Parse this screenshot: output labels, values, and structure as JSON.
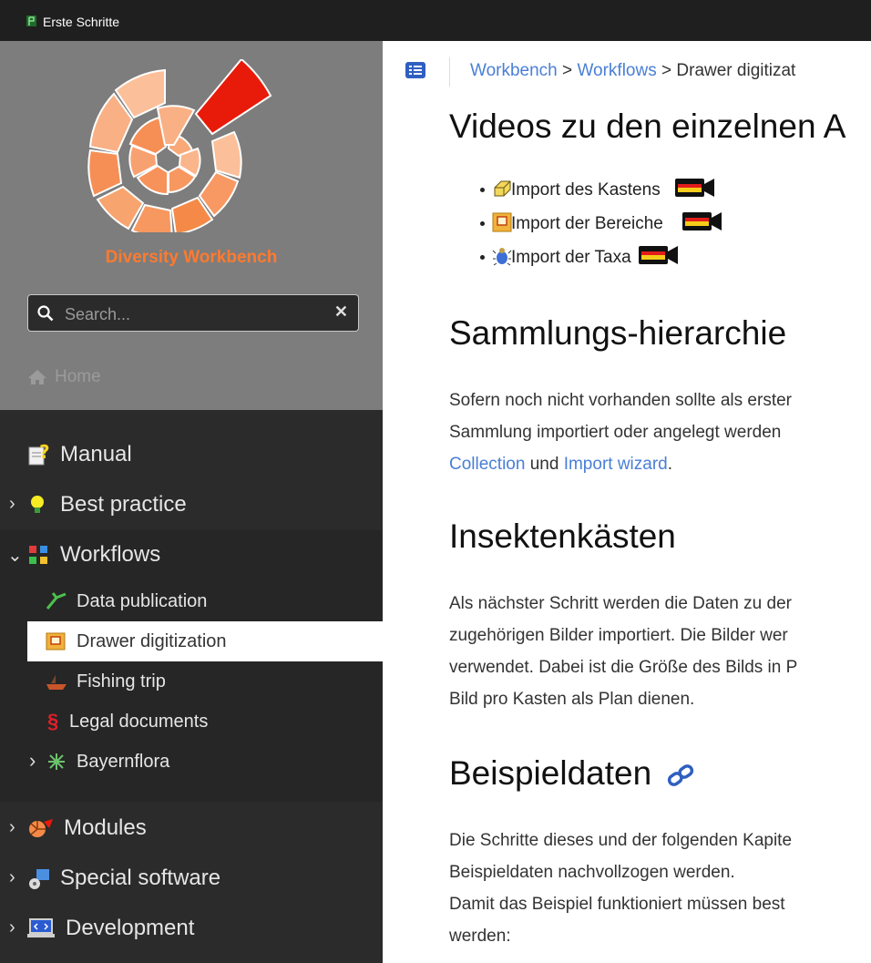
{
  "window": {
    "title": "Erste Schritte"
  },
  "sidebar": {
    "brand": "Diversity Workbench",
    "search": {
      "placeholder": "Search...",
      "clear_label": "✕"
    },
    "home": "Home",
    "nav": [
      {
        "label": "Manual",
        "icon": "manual-icon"
      },
      {
        "label": "Best practice",
        "icon": "lightbulb-icon",
        "expanded": false
      },
      {
        "label": "Workflows",
        "icon": "workflows-icon",
        "expanded": true
      },
      {
        "label": "Modules",
        "icon": "modules-icon",
        "expanded": false
      },
      {
        "label": "Special software",
        "icon": "special-software-icon",
        "expanded": false
      },
      {
        "label": "Development",
        "icon": "development-icon",
        "expanded": false
      }
    ],
    "workflows": [
      {
        "label": "Data publication",
        "icon": "leaf-icon"
      },
      {
        "label": "Drawer digitization",
        "icon": "drawer-icon",
        "active": true
      },
      {
        "label": "Fishing trip",
        "icon": "boat-icon"
      },
      {
        "label": "Legal documents",
        "icon": "paragraph-icon"
      },
      {
        "label": "Bayernflora",
        "icon": "plant-icon",
        "expanded": false
      }
    ]
  },
  "breadcrumb": {
    "items": [
      "Workbench",
      "Workflows"
    ],
    "separator": ">",
    "current": "Drawer digitizat"
  },
  "content": {
    "videos_heading": "Videos zu den einzelnen A",
    "videos": [
      {
        "label": "Import des Kastens",
        "icon": "box-icon"
      },
      {
        "label": "Import der Bereiche",
        "icon": "drawer-icon"
      },
      {
        "label": "Import der Taxa",
        "icon": "beetle-icon"
      }
    ],
    "hierarchy_heading": "Sammlungs-hierarchie",
    "hierarchy_lines": [
      "Sofern noch nicht vorhanden sollte als erster",
      "Sammlung importiert oder angelegt werden"
    ],
    "hierarchy_link1": "Collection",
    "hierarchy_und": "und",
    "hierarchy_link2": "Import wizard",
    "hierarchy_end": ".",
    "drawers_heading": "Insektenkästen",
    "drawers_lines": [
      "Als nächster Schritt werden die Daten zu der",
      "zugehörigen Bilder importiert. Die Bilder wer",
      "verwendet. Dabei ist die Größe des Bilds in P",
      "Bild pro Kasten als Plan dienen."
    ],
    "example_heading": "Beispieldaten",
    "example_lines": [
      "Die Schritte dieses und der folgenden Kapite",
      "Beispieldaten nachvollzogen werden.",
      "Damit das Beispiel funktioniert müssen best",
      "werden:"
    ]
  },
  "colors": {
    "brand": "#ff7a2e",
    "link": "#4a7fd6",
    "sidebar_bg": "#2b2b2b",
    "logo_bg": "#7d7d7d"
  }
}
